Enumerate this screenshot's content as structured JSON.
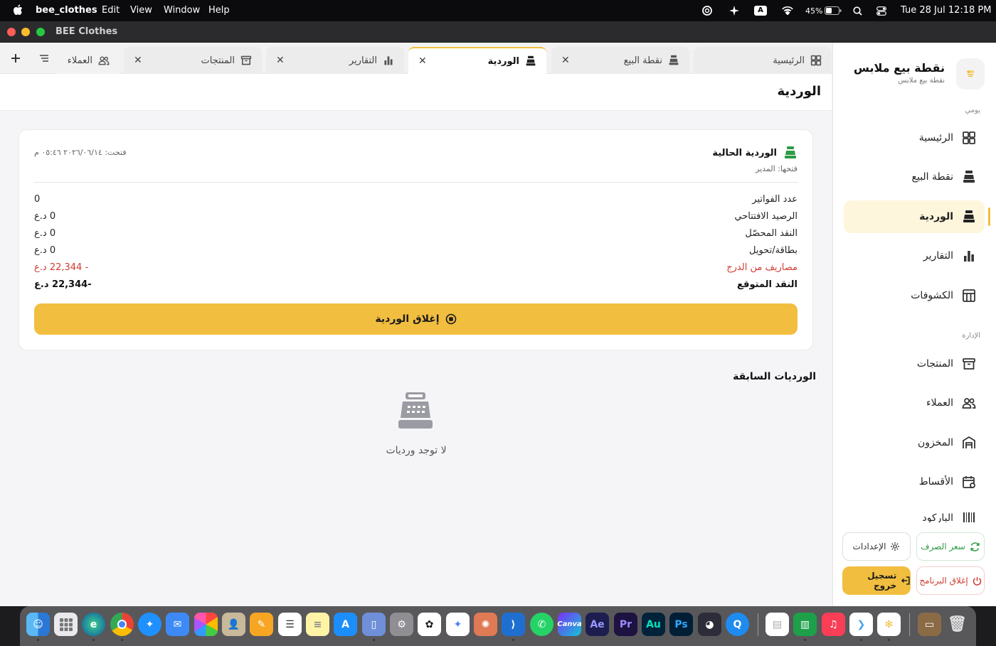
{
  "menubar": {
    "app_name": "bee_clothes",
    "menus": [
      "Edit",
      "View",
      "Window",
      "Help"
    ],
    "battery": "45%",
    "keyboard": "A",
    "datetime": "Tue 28 Jul  12:18 PM"
  },
  "window": {
    "title": "BEE Clothes"
  },
  "sidebar": {
    "brand_title": "نقطة بيع ملابس",
    "brand_subtitle": "نقطة بيع ملابس",
    "section_daily": "يومي",
    "section_admin": "الإدارة",
    "daily_items": [
      {
        "label": "الرئيسية",
        "icon": "dashboard-icon"
      },
      {
        "label": "نقطة البيع",
        "icon": "cash-register-icon"
      },
      {
        "label": "الوردية",
        "icon": "cash-register-icon",
        "active": true
      },
      {
        "label": "التقارير",
        "icon": "bar-chart-icon"
      },
      {
        "label": "الكشوفات",
        "icon": "table-icon"
      }
    ],
    "admin_items": [
      {
        "label": "المنتجات",
        "icon": "archive-icon"
      },
      {
        "label": "العملاء",
        "icon": "users-icon"
      },
      {
        "label": "المخزون",
        "icon": "warehouse-icon"
      },
      {
        "label": "الأقساط",
        "icon": "calendar-icon"
      },
      {
        "label": "الباركود",
        "icon": "barcode-icon"
      }
    ],
    "buttons": {
      "exchange_rate": "سعر الصرف",
      "settings": "الإعدادات",
      "close_app": "إغلاق البرنامج",
      "logout": "تسجيل خروج"
    }
  },
  "tabs": [
    {
      "label": "الرئيسية",
      "closable": false
    },
    {
      "label": "نقطة البيع",
      "closable": true
    },
    {
      "label": "الوردية",
      "closable": true,
      "active": true
    },
    {
      "label": "التقارير",
      "closable": true
    },
    {
      "label": "المنتجات",
      "closable": true
    },
    {
      "label": "العملاء",
      "closable": false
    }
  ],
  "page": {
    "title": "الوردية"
  },
  "current_shift": {
    "title": "الوردية الحالية",
    "opened_by": "فتحها: المدير",
    "opened_at": "فتحت: ٢٠٢٦/٠٦/١٤ ٠٥:٤٦ م",
    "rows": [
      {
        "label": "عدد الفواتير",
        "value": "0"
      },
      {
        "label": "الرصيد الافتتاحي",
        "value": "0 د.ع"
      },
      {
        "label": "النقد المحصّل",
        "value": "0 د.ع"
      },
      {
        "label": "بطاقة/تحويل",
        "value": "0 د.ع"
      },
      {
        "label": "مصاريف من الدرج",
        "value": "- 22,344 د.ع"
      },
      {
        "label": "النقد المتوقع",
        "value": "-22,344 د.ع"
      }
    ],
    "close_button": "إغلاق الوردية"
  },
  "previous_shifts": {
    "title": "الورديات السابقة",
    "empty_text": "لا توجد ورديات"
  },
  "colors": {
    "accent": "#f2be40",
    "negative": "#d03b2f",
    "success": "#2e9b47"
  },
  "dock": {
    "apps": [
      "Finder",
      "Launchpad",
      "Edge",
      "Chrome",
      "Safari",
      "Mail",
      "Photos",
      "Contacts",
      "Pages",
      "Reminders",
      "Notes",
      "App Store",
      "Simulator",
      "System Settings",
      "ChatGPT",
      "Gemini",
      "Claude",
      "VS Code",
      "WhatsApp",
      "Canva",
      "After Effects",
      "Premiere Pro",
      "Audition",
      "Photoshop",
      "DaVinci Resolve",
      "QuickTime",
      "Freeform",
      "Numbers",
      "Music",
      "Flutter",
      "Bee Clothes",
      "Archive",
      "Trash"
    ],
    "labels": {
      "canva": "Canva",
      "ae": "Ae",
      "pr": "Pr",
      "au": "Au",
      "ps": "Ps"
    }
  }
}
